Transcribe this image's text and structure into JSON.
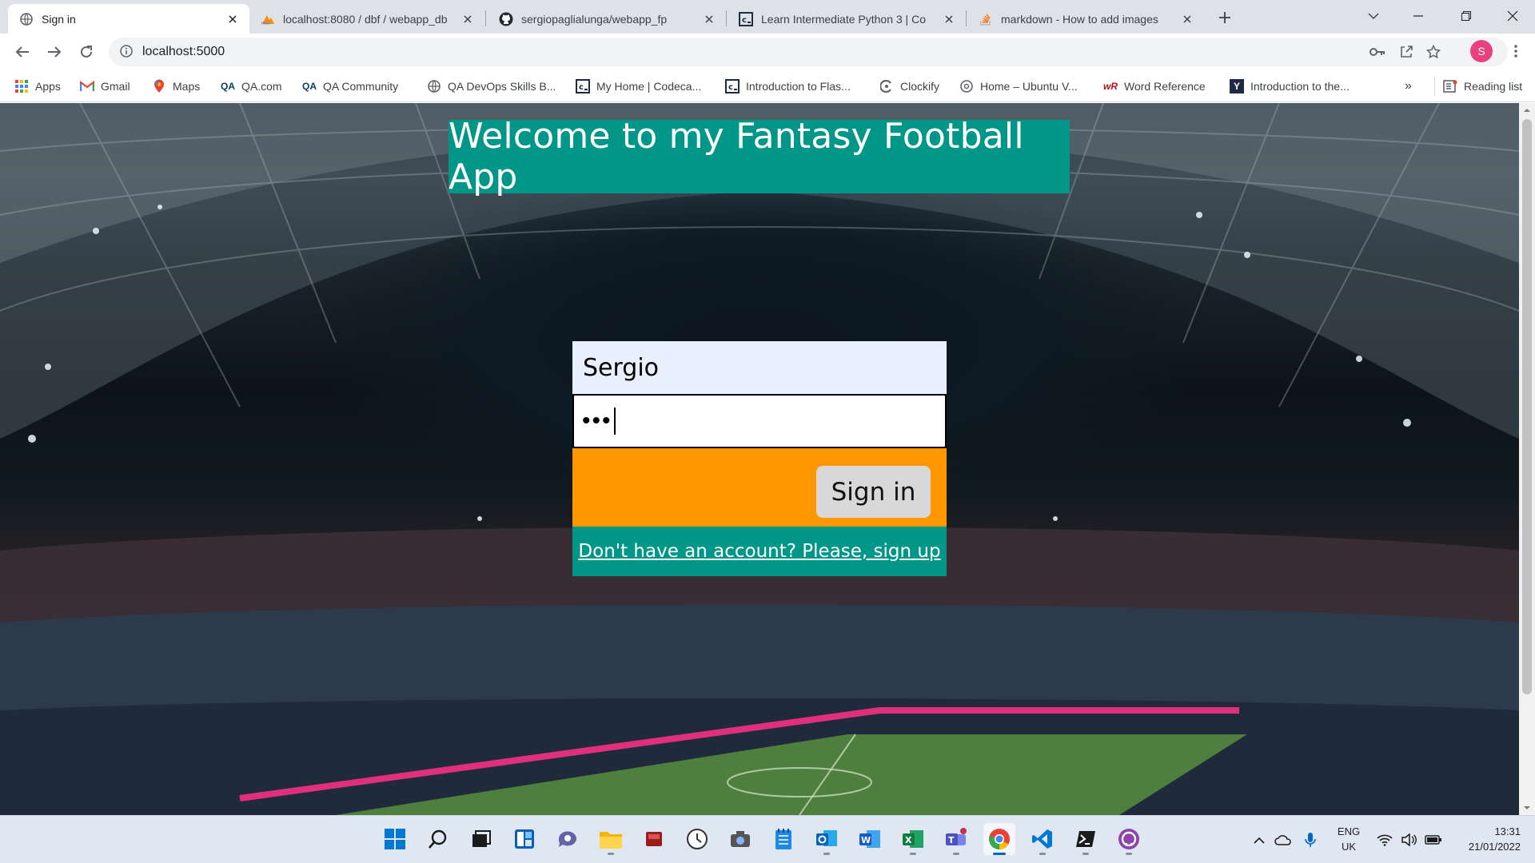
{
  "browser": {
    "tabs": [
      {
        "title": "Sign in",
        "icon": "globe-icon"
      },
      {
        "title": "localhost:8080 / dbf / webapp_db",
        "icon": "phpmyadmin-icon"
      },
      {
        "title": "sergiopaglialunga/webapp_fp",
        "icon": "github-icon"
      },
      {
        "title": "Learn Intermediate Python 3 | Co",
        "icon": "codecademy-icon"
      },
      {
        "title": "markdown - How to add images",
        "icon": "stackoverflow-icon"
      }
    ],
    "url": "localhost:5000",
    "profile_initial": "S",
    "bookmarks": [
      {
        "label": "Apps",
        "icon": "apps-grid-icon"
      },
      {
        "label": "Gmail",
        "icon": "gmail-icon"
      },
      {
        "label": "Maps",
        "icon": "maps-icon"
      },
      {
        "label": "QA.com",
        "icon": "qa-icon"
      },
      {
        "label": "QA Community",
        "icon": "qa-icon"
      },
      {
        "label": "QA DevOps Skills B...",
        "icon": "globe-icon"
      },
      {
        "label": "My Home | Codeca...",
        "icon": "codecademy-icon"
      },
      {
        "label": "Introduction to Flas...",
        "icon": "codecademy-icon"
      },
      {
        "label": "Clockify",
        "icon": "clockify-icon"
      },
      {
        "label": "Home – Ubuntu V...",
        "icon": "globe-icon"
      },
      {
        "label": "Word Reference",
        "icon": "wordreference-icon"
      },
      {
        "label": "Introduction to the...",
        "icon": "y-icon"
      }
    ],
    "bookmarks_overflow": "»",
    "reading_list": "Reading list"
  },
  "page": {
    "heading": "Welcome to my Fantasy Football App",
    "username_value": "Sergio",
    "password_mask": "•••",
    "submit_label": "Sign in",
    "signup_link": "Don't have an account? Please, sign up"
  },
  "colors": {
    "teal": "#009688",
    "orange": "#ff9800",
    "autofill": "#e8f0fe"
  },
  "taskbar": {
    "apps": [
      "windows-start-icon",
      "search-icon",
      "task-view-icon",
      "widgets-icon",
      "chat-icon",
      "file-explorer-icon",
      "app-red-icon",
      "clock-app-icon",
      "camera-icon",
      "notepad-icon",
      "outlook-icon",
      "word-icon",
      "excel-icon",
      "teams-icon",
      "chrome-icon",
      "vscode-icon",
      "terminal-icon",
      "github-desktop-icon"
    ],
    "lang_top": "ENG",
    "lang_bottom": "UK",
    "time": "13:31",
    "date": "21/01/2022"
  }
}
